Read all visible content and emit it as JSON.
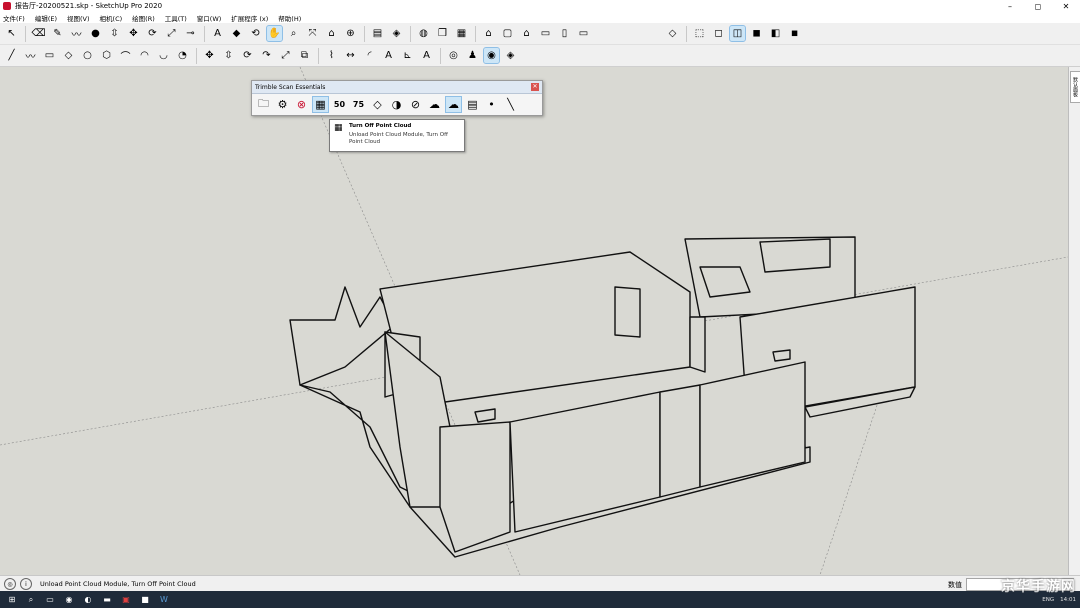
{
  "window": {
    "title": "报告厅-20200521.skp - SketchUp Pro 2020",
    "minimize_icon": "minimize-icon",
    "maximize_icon": "restore-icon",
    "close_icon": "close-icon"
  },
  "menu": [
    "文件(F)",
    "编辑(E)",
    "视图(V)",
    "相机(C)",
    "绘图(R)",
    "工具(T)",
    "窗口(W)",
    "扩展程序 (x)",
    "帮助(H)"
  ],
  "toolbar1": {
    "group1": [
      "select-icon",
      "eraser-icon",
      "pencil-line-icon",
      "freehand-icon",
      "paint-bucket-icon",
      "push-pull-icon",
      "move-icon",
      "rotate-icon",
      "scale-icon",
      "tape-icon",
      "text-icon",
      "paint-icon",
      "orbit-icon",
      "pan-icon",
      "zoom-icon",
      "zoom-extents-icon",
      "warehouse-icon",
      "extension-warehouse-icon",
      "layout-icon",
      "ruby-icon",
      "account-icon",
      "component-icon",
      "scenes-icon",
      "iso-icon",
      "top-icon",
      "front-icon",
      "right-icon",
      "back-icon",
      "left-icon"
    ],
    "group2": [
      "xray-icon",
      "back-edges-icon",
      "wireframe-icon",
      "hidden-line-icon",
      "shaded-icon",
      "shaded-textures-icon",
      "monochrome-icon"
    ],
    "active_index": 13
  },
  "toolbar2": {
    "tools": [
      "line-icon",
      "freehand-icon",
      "rectangle-icon",
      "rotated-rect-icon",
      "circle-icon",
      "polygon-icon",
      "arc-icon",
      "two-point-arc-icon",
      "three-point-arc-icon",
      "pie-icon",
      "move-icon",
      "push-pull-icon",
      "rotate-icon",
      "follow-me-icon",
      "scale-icon",
      "offset-icon",
      "tape-measure-icon",
      "dimension-icon",
      "protractor-icon",
      "text-icon",
      "axes-icon",
      "3d-text-icon",
      "position-camera-icon",
      "walk-icon",
      "look-around-icon",
      "section-plane-icon"
    ],
    "active_index": 24
  },
  "scan_panel": {
    "title": "Trimble Scan Essentials",
    "icons": [
      "folder-icon",
      "settings-icon",
      "cancel-icon",
      "point-cloud-off-icon",
      "50-icon",
      "75-icon",
      "drop-icon",
      "contrast-icon",
      "hatch-icon",
      "cloud-down-icon",
      "cloud-up-icon",
      "cloud-list-icon",
      "point-icon",
      "line-icon"
    ],
    "numbers": {
      "p50": "50",
      "p75": "75"
    }
  },
  "tooltip": {
    "title": "Turn Off Point Cloud",
    "description": "Unload Point Cloud Module, Turn Off Point Cloud",
    "icon": "point-cloud-off-icon"
  },
  "right_tray_tab": "默认面板",
  "status": {
    "text": "Unload Point Cloud Module, Turn Off Point Cloud",
    "measurements_label": "数值",
    "measurements_value": ""
  },
  "taskbar": {
    "time": "14:01",
    "icons": [
      "start-icon",
      "search-icon",
      "task-view-icon",
      "chrome-icon",
      "sketchup-icon",
      "explorer-icon",
      "app-icon",
      "word-icon"
    ],
    "tray_text": "ENG"
  },
  "watermark": "京华手游网",
  "colors": {
    "viewport_bg": "#d9d9d3",
    "model_line": "#111111",
    "model_fill": "#d9d9d3",
    "active_tool": "#cde6f7"
  }
}
